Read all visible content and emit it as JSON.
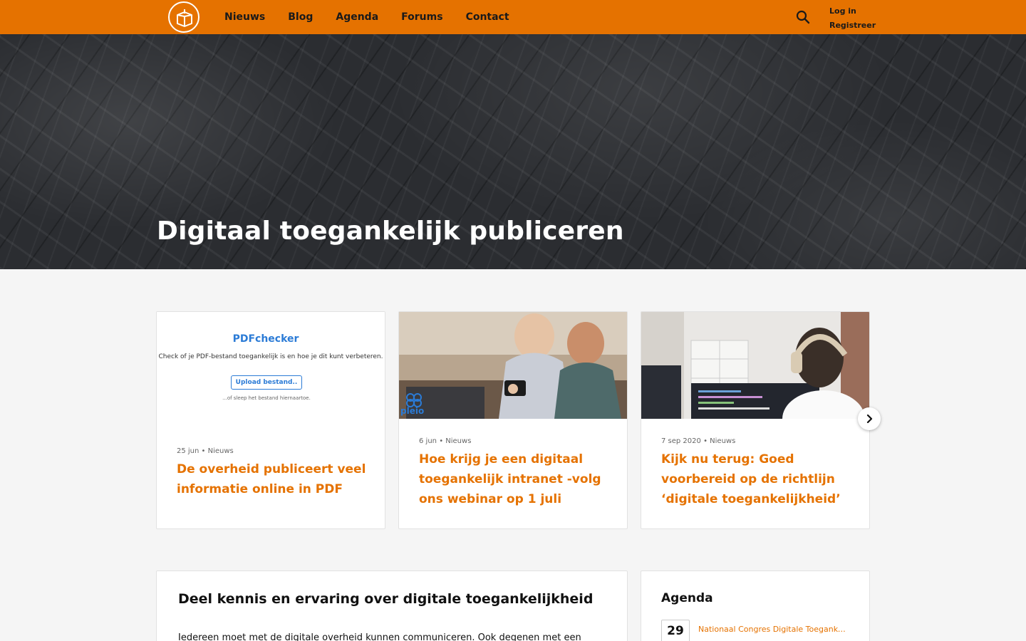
{
  "header": {
    "logo_icon": "book-box-icon",
    "nav": [
      "Nieuws",
      "Blog",
      "Agenda",
      "Forums",
      "Contact"
    ],
    "search_icon": "search-icon",
    "login": "Log in",
    "register": "Registreer",
    "accent_color": "#e57200"
  },
  "hero": {
    "title": "Digitaal toegankelijk publiceren"
  },
  "cards": [
    {
      "date": "25 jun",
      "category": "Nieuws",
      "title": "De overheid publiceert veel informatie online in PDF",
      "image": {
        "heading": "PDFchecker",
        "subtitle": "Check of je PDF-bestand toegankelijk is en hoe je dit kunt verbeteren.",
        "button": "Upload bestand..",
        "hint": "...of sleep het bestand hiernaartoe."
      }
    },
    {
      "date": "6 jun",
      "category": "Nieuws",
      "title": "Hoe krijg je een digitaal toegankelijk intranet -volg ons webinar op 1 juli",
      "image": {
        "logo_text": "pleio"
      }
    },
    {
      "date": "7 sep 2020",
      "category": "Nieuws",
      "title": "Kijk nu terug: Goed voorbereid op de richtlijn ‘digitale toegankelijkheid’"
    }
  ],
  "carousel": {
    "next_icon": "chevron-right-icon"
  },
  "about": {
    "title": "Deel kennis en ervaring over digitale toegankelijkheid",
    "text": "Iedereen moet met de digitale overheid kunnen communiceren. Ook degenen met een"
  },
  "agenda": {
    "title": "Agenda",
    "events": [
      {
        "day": "29",
        "title": "Nationaal Congres Digitale Toegankelijkheid"
      }
    ]
  }
}
